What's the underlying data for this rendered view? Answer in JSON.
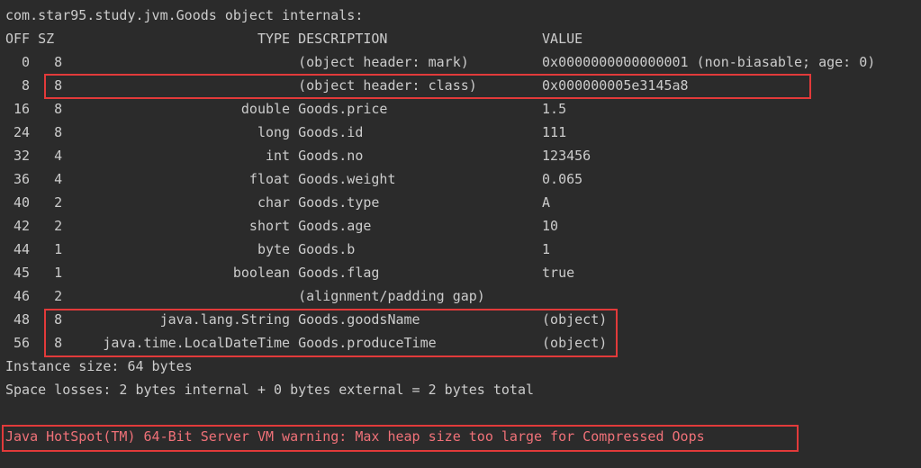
{
  "title_line": "com.star95.study.jvm.Goods object internals:",
  "header": {
    "off": "OFF",
    "sz": "SZ",
    "type": "TYPE",
    "desc": "DESCRIPTION",
    "val": "VALUE"
  },
  "rows": [
    {
      "off": "0",
      "sz": "8",
      "type": "",
      "desc": "(object header: mark)",
      "val": "0x0000000000000001 (non-biasable; age: 0)"
    },
    {
      "off": "8",
      "sz": "8",
      "type": "",
      "desc": "(object header: class)",
      "val": "0x000000005e3145a8"
    },
    {
      "off": "16",
      "sz": "8",
      "type": "double",
      "desc": "Goods.price",
      "val": "1.5"
    },
    {
      "off": "24",
      "sz": "8",
      "type": "long",
      "desc": "Goods.id",
      "val": "111"
    },
    {
      "off": "32",
      "sz": "4",
      "type": "int",
      "desc": "Goods.no",
      "val": "123456"
    },
    {
      "off": "36",
      "sz": "4",
      "type": "float",
      "desc": "Goods.weight",
      "val": "0.065"
    },
    {
      "off": "40",
      "sz": "2",
      "type": "char",
      "desc": "Goods.type",
      "val": "A"
    },
    {
      "off": "42",
      "sz": "2",
      "type": "short",
      "desc": "Goods.age",
      "val": "10"
    },
    {
      "off": "44",
      "sz": "1",
      "type": "byte",
      "desc": "Goods.b",
      "val": "1"
    },
    {
      "off": "45",
      "sz": "1",
      "type": "boolean",
      "desc": "Goods.flag",
      "val": "true"
    },
    {
      "off": "46",
      "sz": "2",
      "type": "",
      "desc": "(alignment/padding gap)",
      "val": ""
    },
    {
      "off": "48",
      "sz": "8",
      "type": "java.lang.String",
      "desc": "Goods.goodsName",
      "val": "(object)"
    },
    {
      "off": "56",
      "sz": "8",
      "type": "java.time.LocalDateTime",
      "desc": "Goods.produceTime",
      "val": "(object)"
    }
  ],
  "instance_size": "Instance size: 64 bytes",
  "space_losses": "Space losses: 2 bytes internal + 0 bytes external = 2 bytes total",
  "warning": "Java HotSpot(TM) 64-Bit Server VM warning: Max heap size too large for Compressed Oops",
  "layout": {
    "col_off_w": 3,
    "col_sz_w": 3,
    "col_type_w": 27,
    "col_desc_w": 30
  }
}
